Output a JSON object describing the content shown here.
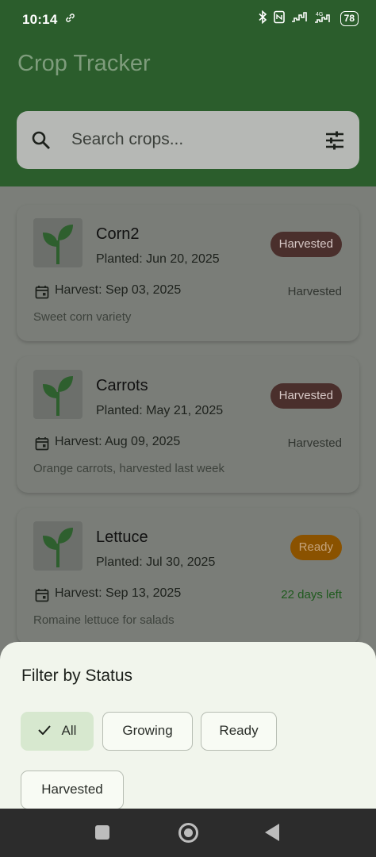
{
  "status_bar": {
    "time": "10:14",
    "link_icon": "link-icon",
    "battery": "78"
  },
  "app": {
    "title": "Crop Tracker"
  },
  "search": {
    "placeholder": "Search crops...",
    "icon": "search-icon",
    "filter_icon": "tune-icon"
  },
  "crops": [
    {
      "name": "Corn2",
      "planted": "Planted: Jun 20, 2025",
      "badge": "Harvested",
      "harvest": "Harvest: Sep 03, 2025",
      "status": "Harvested",
      "note": "Sweet corn variety"
    },
    {
      "name": "Carrots",
      "planted": "Planted: May 21, 2025",
      "badge": "Harvested",
      "harvest": "Harvest: Aug 09, 2025",
      "status": "Harvested",
      "note": "Orange carrots, harvested last week"
    },
    {
      "name": "Lettuce",
      "planted": "Planted: Jul 30, 2025",
      "badge": "Ready",
      "harvest": "Harvest: Sep 13, 2025",
      "status": "22 days left",
      "note": "Romaine lettuce for salads"
    }
  ],
  "filter": {
    "title": "Filter by Status",
    "chips": [
      {
        "label": "All",
        "selected": true
      },
      {
        "label": "Growing",
        "selected": false
      },
      {
        "label": "Ready",
        "selected": false
      },
      {
        "label": "Harvested",
        "selected": false
      }
    ]
  },
  "colors": {
    "header": "#2b5d2c",
    "plant": "#2e7d32",
    "harvested_badge": "#4a2f2c",
    "ready_badge": "#8a5200",
    "sheet": "#f1f5ec"
  }
}
